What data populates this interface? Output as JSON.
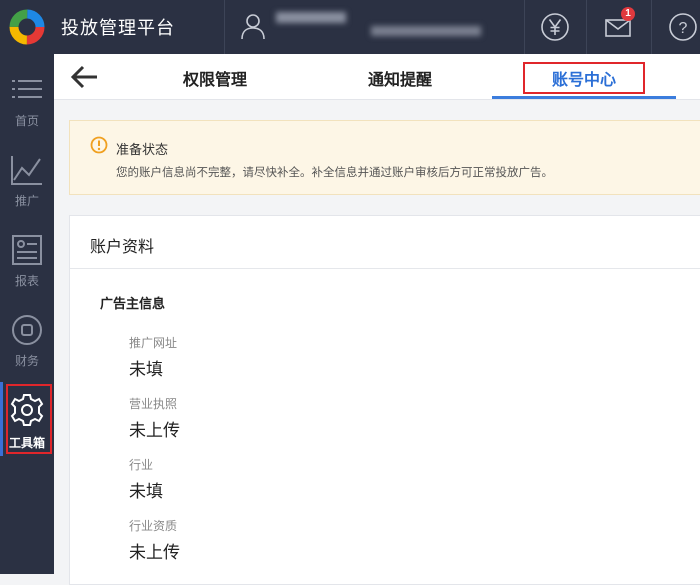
{
  "app": {
    "title": "投放管理平台"
  },
  "header": {
    "icons": [
      "yen-icon",
      "mail-icon",
      "help-icon"
    ],
    "notification_count": "1"
  },
  "sidebar": {
    "items": [
      {
        "label": "首页",
        "icon": "list-icon"
      },
      {
        "label": "推广",
        "icon": "line-chart-icon"
      },
      {
        "label": "报表",
        "icon": "report-icon"
      },
      {
        "label": "财务",
        "icon": "finance-icon"
      },
      {
        "label": "工具箱",
        "icon": "gear-icon",
        "active": true
      }
    ]
  },
  "tabs": {
    "items": [
      {
        "label": "权限管理"
      },
      {
        "label": "通知提醒"
      },
      {
        "label": "账号中心",
        "active": true
      }
    ]
  },
  "notice": {
    "title": "准备状态",
    "text": "您的账户信息尚不完整，请尽快补全。补全信息并通过账户审核后方可正常投放广告。"
  },
  "account": {
    "title": "账户资料",
    "section_title": "广告主信息",
    "fields": [
      {
        "label": "推广网址",
        "value": "未填"
      },
      {
        "label": "营业执照",
        "value": "未上传"
      },
      {
        "label": "行业",
        "value": "未填"
      },
      {
        "label": "行业资质",
        "value": "未上传"
      }
    ]
  },
  "colors": {
    "topbar_bg": "#2b3143",
    "accent": "#2b6fd6",
    "highlight_box": "#e0262b",
    "notice_bg": "#fdf6e6",
    "warning": "#f0a020"
  }
}
